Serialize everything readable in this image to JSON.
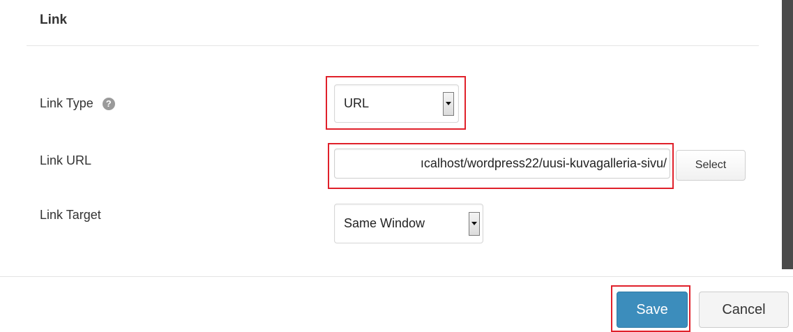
{
  "dialog": {
    "title": "Link"
  },
  "fields": {
    "link_type": {
      "label": "Link Type",
      "value": "URL",
      "help_icon": "question-circle-icon"
    },
    "link_url": {
      "label": "Link URL",
      "value": "ıcalhost/wordpress22/uusi-kuvagalleria-sivu/",
      "select_button_label": "Select"
    },
    "link_target": {
      "label": "Link Target",
      "value": "Same Window"
    }
  },
  "footer": {
    "save_label": "Save",
    "cancel_label": "Cancel"
  },
  "colors": {
    "highlight": "#e0202a",
    "primary_button": "#3c8dbc",
    "scrollbar": "#4a4a4a"
  }
}
